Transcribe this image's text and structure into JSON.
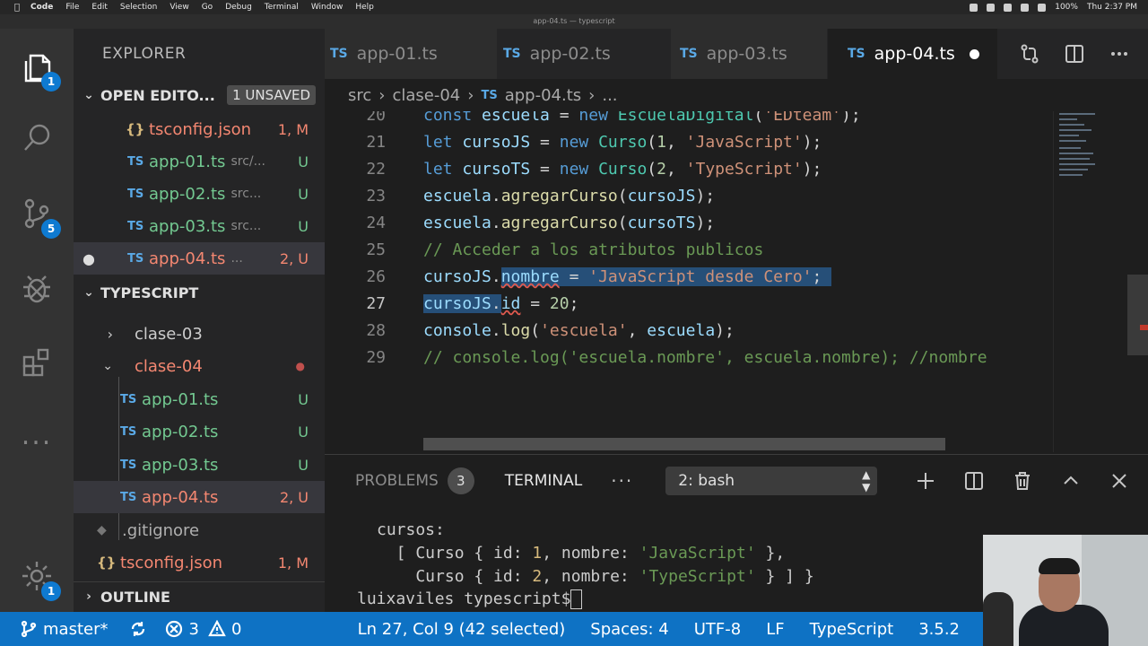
{
  "menubar": {
    "app": "Code",
    "items": [
      "File",
      "Edit",
      "Selection",
      "View",
      "Go",
      "Debug",
      "Terminal",
      "Window",
      "Help"
    ],
    "battery": "100%",
    "clock": "Thu 2:37 PM"
  },
  "window_title": "app-04.ts — typescript",
  "activity": {
    "explorer_badge": "1",
    "scm_badge": "5",
    "settings_badge": "1",
    "more": "..."
  },
  "sidebar": {
    "title": "EXPLORER",
    "open_editors": {
      "label": "OPEN EDITO...",
      "unsaved": "1 UNSAVED",
      "items": [
        {
          "icon": "{}",
          "name": "tsconfig.json",
          "dir": "",
          "status": "1, M"
        },
        {
          "icon": "TS",
          "name": "app-01.ts",
          "dir": "src/...",
          "status": "U"
        },
        {
          "icon": "TS",
          "name": "app-02.ts",
          "dir": "src...",
          "status": "U"
        },
        {
          "icon": "TS",
          "name": "app-03.ts",
          "dir": "src...",
          "status": "U"
        },
        {
          "icon": "TS",
          "name": "app-04.ts",
          "dir": "...",
          "status": "2, U"
        }
      ]
    },
    "workspace": {
      "label": "TYPESCRIPT",
      "folders": [
        {
          "name": "clase-03"
        },
        {
          "name": "clase-04"
        }
      ],
      "files": [
        {
          "icon": "TS",
          "name": "app-01.ts",
          "status": "U"
        },
        {
          "icon": "TS",
          "name": "app-02.ts",
          "status": "U"
        },
        {
          "icon": "TS",
          "name": "app-03.ts",
          "status": "U"
        },
        {
          "icon": "TS",
          "name": "app-04.ts",
          "status": "2, U"
        }
      ],
      "gitignore": ".gitignore",
      "tsconfig": {
        "icon": "{}",
        "name": "tsconfig.json",
        "status": "1, M"
      }
    },
    "outline": "OUTLINE"
  },
  "tabs": [
    {
      "icon": "TS",
      "label": "app-01.ts"
    },
    {
      "icon": "TS",
      "label": "app-02.ts"
    },
    {
      "icon": "TS",
      "label": "app-03.ts"
    },
    {
      "icon": "TS",
      "label": "app-04.ts"
    }
  ],
  "breadcrumb": {
    "root": "src",
    "folder": "clase-04",
    "icon": "TS",
    "file": "app-04.ts",
    "more": "..."
  },
  "editor": {
    "line_numbers": [
      "20",
      "21",
      "22",
      "23",
      "24",
      "25",
      "26",
      "27",
      "28",
      "29"
    ],
    "lines": {
      "l20": {
        "kw": "const",
        "v": "escuela",
        "eq": " = ",
        "new": "new",
        "cls": "EscuelaDigital",
        "open": "(",
        "str": "'EDteam'",
        "close": ");"
      },
      "l21": {
        "kw": "let",
        "v": "cursoJS",
        "eq": " = ",
        "new": "new",
        "cls": "Curso",
        "open": "(",
        "num": "1",
        "comma": ", ",
        "str": "'JavaScript'",
        "close": ");"
      },
      "l22": {
        "kw": "let",
        "v": "cursoTS",
        "eq": " = ",
        "new": "new",
        "cls": "Curso",
        "open": "(",
        "num": "2",
        "comma": ", ",
        "str": "'TypeScript'",
        "close": ");"
      },
      "l23": {
        "obj": "escuela",
        "dot": ".",
        "fn": "agregarCurso",
        "open": "(",
        "arg": "cursoJS",
        "close": ");"
      },
      "l24": {
        "obj": "escuela",
        "dot": ".",
        "fn": "agregarCurso",
        "open": "(",
        "arg": "cursoTS",
        "close": ");"
      },
      "l25": {
        "cmt": "// Acceder a los atributos publicos"
      },
      "l26": {
        "obj": "cursoJS",
        "dot": ".",
        "prop": "nombre",
        "eq": " = ",
        "str": "'JavaScript desde Cero'",
        "end": ";"
      },
      "l27": {
        "obj": "cursoJS",
        "dot": ".",
        "prop": "id",
        "eq": " = ",
        "num": "20",
        "end": ";"
      },
      "l28": {
        "obj": "console",
        "dot": ".",
        "fn": "log",
        "open": "(",
        "str": "'escuela'",
        "comma": ", ",
        "arg": "escuela",
        "close": ");"
      },
      "l29": {
        "cmt": "// console.log('escuela.nombre', escuela.nombre); //nombre"
      }
    }
  },
  "panel": {
    "tabs": {
      "problems": "PROBLEMS",
      "problems_count": "3",
      "terminal": "TERMINAL",
      "more": "···"
    },
    "terminal_select": "2: bash",
    "terminal_lines": {
      "t1": "cursos:",
      "t2": {
        "a": "  [ Curso { id: ",
        "num": "1",
        "b": ", nombre: ",
        "str": "'JavaScript'",
        "c": " },"
      },
      "t3": {
        "a": "    Curso { id: ",
        "num": "2",
        "b": ", nombre: ",
        "str": "'TypeScript'",
        "c": " } ] }"
      },
      "t4": "luixaviles typescript$"
    }
  },
  "statusbar": {
    "branch": "master*",
    "errors": "3",
    "warnings": "0",
    "position": "Ln 27, Col 9 (42 selected)",
    "spaces": "Spaces: 4",
    "encoding": "UTF-8",
    "eol": "LF",
    "language": "TypeScript",
    "version": "3.5.2"
  },
  "colors": {
    "accent": "#0e72c4",
    "ts_icon": "#5aa9e6",
    "untracked": "#73c991",
    "modified": "#f48771",
    "selection": "#264f78"
  }
}
